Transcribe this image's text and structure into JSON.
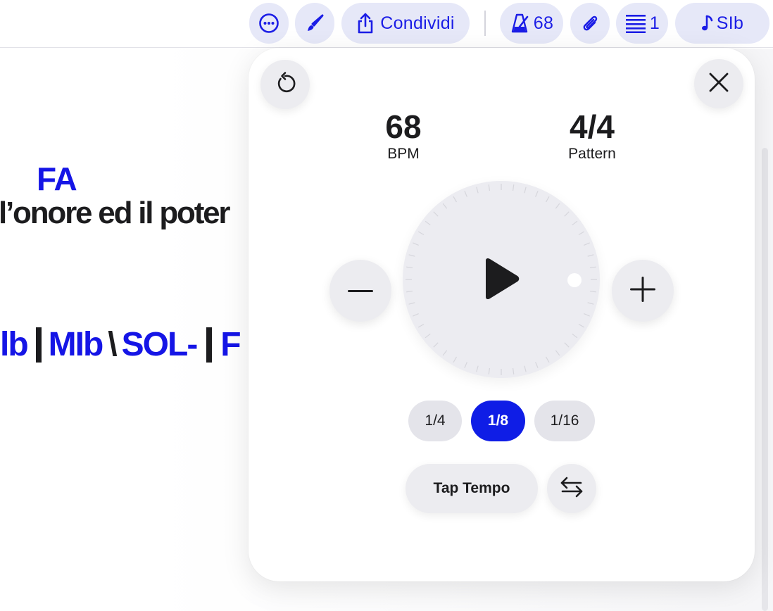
{
  "toolbar": {
    "more_icon": "ellipsis-circle-icon",
    "brush_icon": "paintbrush-icon",
    "share_icon": "share-icon",
    "share_label": "Condividi",
    "metronome_icon": "metronome-icon",
    "metronome_bpm": "68",
    "attachment_icon": "paperclip-icon",
    "text_size_icon": "text-lines-icon",
    "text_size_value": "1",
    "key_icon": "music-note-icon",
    "key_label": "SIb",
    "accent_color": "#1b1de6"
  },
  "sheet": {
    "chord_above": "FA",
    "lyric": "l’onore ed il poter",
    "chord_row": {
      "chord1": "lb",
      "chord2": "MIb",
      "chord3": "SOL-",
      "chord4": "F"
    }
  },
  "metronome": {
    "reset_icon": "reset-arrow-icon",
    "close_icon": "close-icon",
    "bpm_value": "68",
    "bpm_caption": "BPM",
    "pattern_value": "4/4",
    "pattern_caption": "Pattern",
    "play_icon": "play-icon",
    "decrease_icon": "minus-icon",
    "increase_icon": "plus-icon",
    "subdivisions": [
      {
        "label": "1/4",
        "active": false
      },
      {
        "label": "1/8",
        "active": true
      },
      {
        "label": "1/16",
        "active": false
      }
    ],
    "tap_tempo_label": "Tap Tempo",
    "swap_icon": "swap-arrows-icon"
  }
}
